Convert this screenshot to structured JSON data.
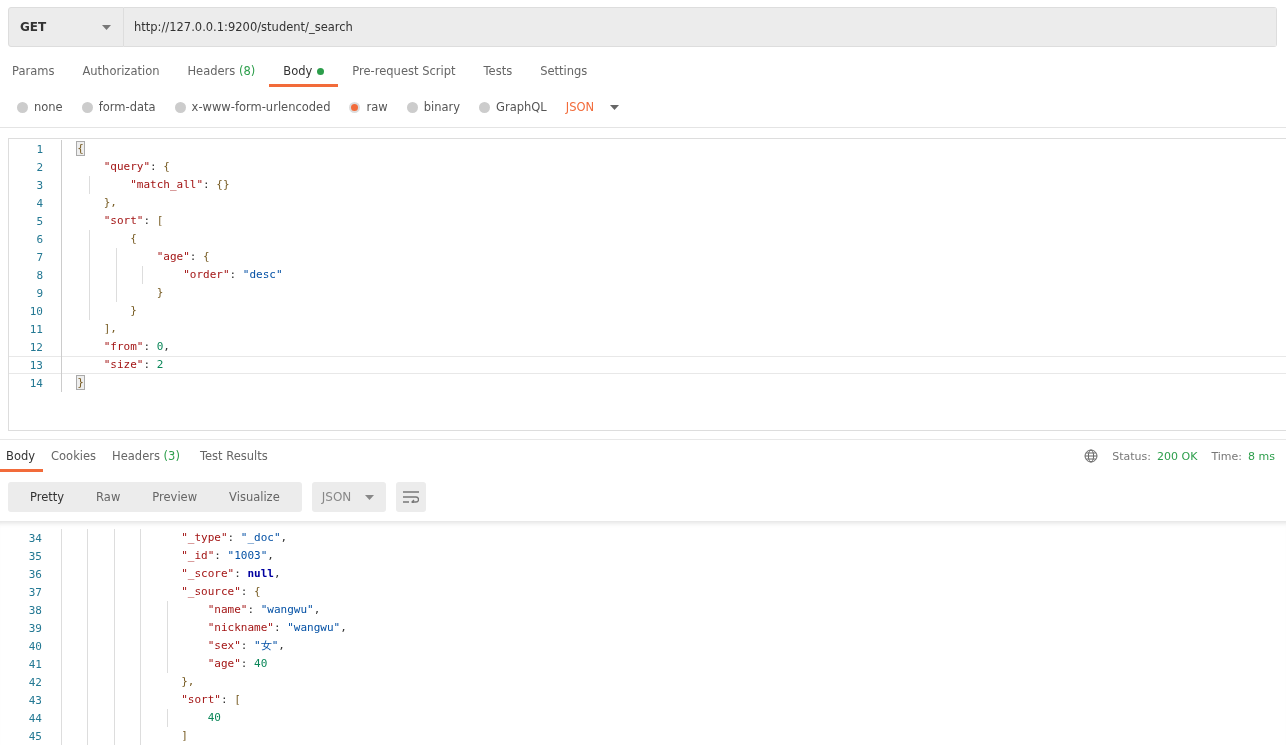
{
  "request": {
    "method": "GET",
    "url": "http://127.0.0.1:9200/student/_search"
  },
  "request_tabs": [
    {
      "label": "Params",
      "selected": false
    },
    {
      "label": "Authorization",
      "selected": false
    },
    {
      "label": "Headers",
      "count": "(8)",
      "selected": false
    },
    {
      "label": "Body",
      "dot": true,
      "selected": true
    },
    {
      "label": "Pre-request Script",
      "selected": false
    },
    {
      "label": "Tests",
      "selected": false
    },
    {
      "label": "Settings",
      "selected": false
    }
  ],
  "body_types": [
    {
      "label": "none",
      "selected": false
    },
    {
      "label": "form-data",
      "selected": false
    },
    {
      "label": "x-www-form-urlencoded",
      "selected": false
    },
    {
      "label": "raw",
      "selected": true
    },
    {
      "label": "binary",
      "selected": false
    },
    {
      "label": "GraphQL",
      "selected": false
    }
  ],
  "body_format": "JSON",
  "request_body": [
    {
      "number": "1",
      "active": false,
      "tokens": [
        {
          "kind": "bracket",
          "text": "{",
          "matched": true
        }
      ]
    },
    {
      "number": "2",
      "active": false,
      "tokens": [
        {
          "kind": "key",
          "text": "    \"query\""
        },
        {
          "kind": "punct",
          "text": ": "
        },
        {
          "kind": "bracket",
          "text": "{"
        }
      ]
    },
    {
      "number": "3",
      "active": false,
      "tokens": [
        {
          "kind": "key",
          "text": "        \"match_all\""
        },
        {
          "kind": "punct",
          "text": ": "
        },
        {
          "kind": "bracket",
          "text": "{}"
        }
      ]
    },
    {
      "number": "4",
      "active": false,
      "tokens": [
        {
          "kind": "bracket",
          "text": "    },"
        }
      ]
    },
    {
      "number": "5",
      "active": false,
      "tokens": [
        {
          "kind": "key",
          "text": "    \"sort\""
        },
        {
          "kind": "punct",
          "text": ": "
        },
        {
          "kind": "bracket",
          "text": "["
        }
      ]
    },
    {
      "number": "6",
      "active": false,
      "tokens": [
        {
          "kind": "bracket",
          "text": "        {"
        }
      ]
    },
    {
      "number": "7",
      "active": false,
      "tokens": [
        {
          "kind": "key",
          "text": "            \"age\""
        },
        {
          "kind": "punct",
          "text": ": "
        },
        {
          "kind": "bracket",
          "text": "{"
        }
      ]
    },
    {
      "number": "8",
      "active": false,
      "tokens": [
        {
          "kind": "key",
          "text": "                \"order\""
        },
        {
          "kind": "punct",
          "text": ": "
        },
        {
          "kind": "string",
          "text": "\"desc\""
        }
      ]
    },
    {
      "number": "9",
      "active": false,
      "tokens": [
        {
          "kind": "bracket",
          "text": "            }"
        }
      ]
    },
    {
      "number": "10",
      "active": false,
      "tokens": [
        {
          "kind": "bracket",
          "text": "        }"
        }
      ]
    },
    {
      "number": "11",
      "active": false,
      "tokens": [
        {
          "kind": "bracket",
          "text": "    ],"
        }
      ]
    },
    {
      "number": "12",
      "active": false,
      "tokens": [
        {
          "kind": "key",
          "text": "    \"from\""
        },
        {
          "kind": "punct",
          "text": ": "
        },
        {
          "kind": "number",
          "text": "0"
        },
        {
          "kind": "punct",
          "text": ","
        }
      ]
    },
    {
      "number": "13",
      "active": true,
      "tokens": [
        {
          "kind": "key",
          "text": "    \"size\""
        },
        {
          "kind": "punct",
          "text": ": "
        },
        {
          "kind": "number",
          "text": "2"
        }
      ]
    },
    {
      "number": "14",
      "active": false,
      "tokens": [
        {
          "kind": "bracket",
          "text": "}",
          "matched": true
        }
      ]
    }
  ],
  "response_tabs": [
    {
      "label": "Body",
      "selected": true
    },
    {
      "label": "Cookies",
      "selected": false
    },
    {
      "label": "Headers",
      "count": "(3)",
      "selected": false
    },
    {
      "label": "Test Results",
      "selected": false
    }
  ],
  "status": {
    "label": "Status:",
    "value": "200 OK"
  },
  "time": {
    "label": "Time:",
    "value": "8 ms"
  },
  "view_modes": [
    {
      "label": "Pretty",
      "selected": true
    },
    {
      "label": "Raw",
      "selected": false
    },
    {
      "label": "Preview",
      "selected": false
    },
    {
      "label": "Visualize",
      "selected": false
    }
  ],
  "response_format": "JSON",
  "response_body": [
    {
      "number": "34",
      "tokens": [
        {
          "kind": "key",
          "text": "                \"_type\""
        },
        {
          "kind": "punct",
          "text": ": "
        },
        {
          "kind": "string",
          "text": "\"_doc\""
        },
        {
          "kind": "punct",
          "text": ","
        }
      ]
    },
    {
      "number": "35",
      "tokens": [
        {
          "kind": "key",
          "text": "                \"_id\""
        },
        {
          "kind": "punct",
          "text": ": "
        },
        {
          "kind": "string",
          "text": "\"1003\""
        },
        {
          "kind": "punct",
          "text": ","
        }
      ]
    },
    {
      "number": "36",
      "tokens": [
        {
          "kind": "key",
          "text": "                \"_score\""
        },
        {
          "kind": "punct",
          "text": ": "
        },
        {
          "kind": "keyword",
          "text": "null"
        },
        {
          "kind": "punct",
          "text": ","
        }
      ]
    },
    {
      "number": "37",
      "tokens": [
        {
          "kind": "key",
          "text": "                \"_source\""
        },
        {
          "kind": "punct",
          "text": ": "
        },
        {
          "kind": "bracket",
          "text": "{"
        }
      ]
    },
    {
      "number": "38",
      "tokens": [
        {
          "kind": "key",
          "text": "                    \"name\""
        },
        {
          "kind": "punct",
          "text": ": "
        },
        {
          "kind": "string",
          "text": "\"wangwu\""
        },
        {
          "kind": "punct",
          "text": ","
        }
      ]
    },
    {
      "number": "39",
      "tokens": [
        {
          "kind": "key",
          "text": "                    \"nickname\""
        },
        {
          "kind": "punct",
          "text": ": "
        },
        {
          "kind": "string",
          "text": "\"wangwu\""
        },
        {
          "kind": "punct",
          "text": ","
        }
      ]
    },
    {
      "number": "40",
      "tokens": [
        {
          "kind": "key",
          "text": "                    \"sex\""
        },
        {
          "kind": "punct",
          "text": ": "
        },
        {
          "kind": "string",
          "text": "\"女\""
        },
        {
          "kind": "punct",
          "text": ","
        }
      ]
    },
    {
      "number": "41",
      "tokens": [
        {
          "kind": "key",
          "text": "                    \"age\""
        },
        {
          "kind": "punct",
          "text": ": "
        },
        {
          "kind": "number",
          "text": "40"
        }
      ]
    },
    {
      "number": "42",
      "tokens": [
        {
          "kind": "bracket",
          "text": "                },"
        }
      ]
    },
    {
      "number": "43",
      "tokens": [
        {
          "kind": "key",
          "text": "                \"sort\""
        },
        {
          "kind": "punct",
          "text": ": "
        },
        {
          "kind": "bracket",
          "text": "["
        }
      ]
    },
    {
      "number": "44",
      "tokens": [
        {
          "kind": "number",
          "text": "                    40"
        }
      ]
    },
    {
      "number": "45",
      "tokens": [
        {
          "kind": "bracket",
          "text": "                ]"
        }
      ]
    }
  ]
}
